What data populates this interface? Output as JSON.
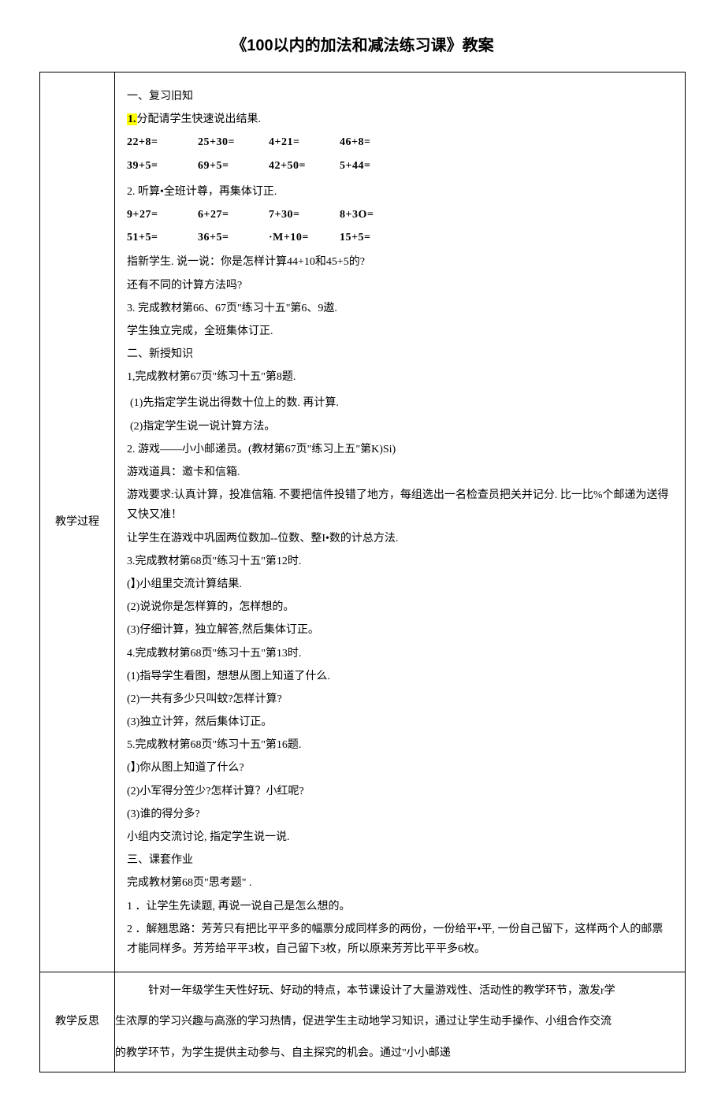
{
  "title": "《100以内的加法和减法练习课》教案",
  "row1": {
    "label": "教学过程",
    "lines": {
      "s1": "一、复习旧知",
      "p1_num": "1.",
      "p1_text": "分配请学生快速说出结果.",
      "eq1a": "22+8=",
      "eq1b": "25+30=",
      "eq1c": "4+21=",
      "eq1d": "46+8=",
      "eq2a": "39+5=",
      "eq2b": "69+5=",
      "eq2c": "42+50=",
      "eq2d": "5+44=",
      "p2": "2. 听算•全班计尊，再集体订正.",
      "eq3a": "9+27=",
      "eq3b": "6+27=",
      "eq3c": "7+30=",
      "eq3d": "8+3O=",
      "eq4a": "51+5=",
      "eq4b": "36+5=",
      "eq4c": "·M+10=",
      "eq4d": "15+5=",
      "p3": "指新学生. 说一说：你是怎样计算44+10和45+5的?",
      "p4": "还有不同的计算方法吗?",
      "p5": "3. 完成教材第66、67页\"练习十五\"第6、9遨.",
      "p6": "学生独立完成，全班集体订正.",
      "s2": "二、新授知识",
      "p7": "1,完成教材第67页\"练习十五\"第8题.",
      "p8": "(1)先指定学生说出得数十位上的数. 再计算.",
      "p9": "(2)指定学生说一说计算方法。",
      "p10": "2. 游戏——小小邮递员。(教材第67页\"练习上五\"第K)Si)",
      "p11": "游戏道具：邀卡和信箱.",
      "p12": "游戏要求:认真计算，投准信箱. 不要把信件投错了地方，每组选出一名检查员把关并记分. 比一比%个邮递为送得又快又准！",
      "p13": "让学生在游戏中巩固两位数加--位数、整I•数的计总方法.",
      "p14": "3.完成教材第68页\"练习十五\"第12时.",
      "p15": "(】)小组里交流计算结果.",
      "p16": "(2)说说你是怎样算的，怎样想的。",
      "p17": "(3)仔细计算，独立解答,然后集体订正。",
      "p18": "4.完成教材第68页\"练习十五\"第13时.",
      "p19": "(1)指导学生看图，想想从图上知道了什么.",
      "p20": "(2)一共有多少只叫蚊?怎样计算?",
      "p21": "(3)独立计笄，然后集体订正。",
      "p22": "5.完成教材第68页\"练习十五\"第16题.",
      "p23": "(】)你从图上知道了什么?",
      "p24": "(2)小军得分笠少?怎样计算？小红呢?",
      "p25": "(3)谁的得分多?",
      "p26": "小组内交流讨论, 指定学生说一说.",
      "s3": "三、课套作业",
      "p27": "完成教材第68页\"思考题\" .",
      "p28": "1 ．让学生先读题, 再说一说自己是怎么想的。",
      "p29": "2 ．解翘思路：芳芳只有把比平平多的幅票分成同样多的两份，一份给平•平, 一份自己留下，这样两个人的邮票才能同样多。芳芳给平平3枚，自己留下3枚，所以原来芳芳比平平多6枚。"
    }
  },
  "row2": {
    "label": "教学反思",
    "text1": "针对一年级学生天性好玩、好动的特点，本节课设计了大量游戏性、活动性的教学环节，激发r学",
    "text2": "生浓厚的学习兴趣与高涨的学习热情，促进学生主动地学习知识，通过让学生动手操作、小组合作交流",
    "text3": "的教学环节，为学生提供主动参与、自主探究的机会。通过\"小小邮递"
  }
}
